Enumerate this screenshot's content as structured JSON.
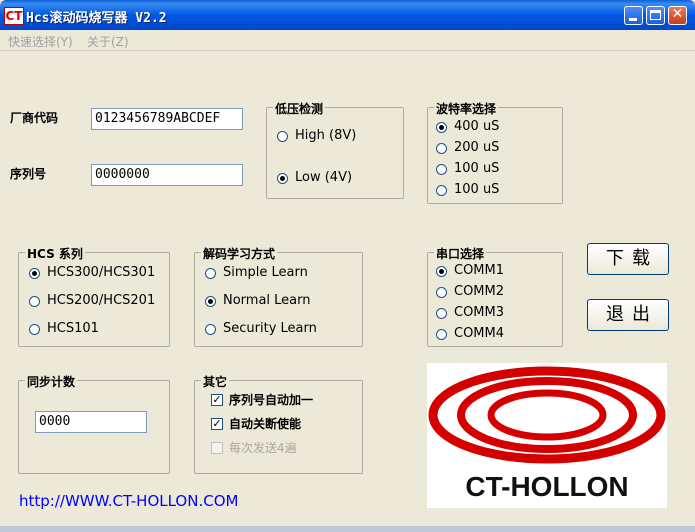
{
  "window": {
    "icon": "CT",
    "title": "Hcs滚动码烧写器 V2.2"
  },
  "menu": {
    "items": [
      "快速选择(Y)",
      "关于(Z)"
    ]
  },
  "manufacturer_code": {
    "label": "厂商代码",
    "value": "0123456789ABCDEF"
  },
  "serial_number": {
    "label": "序列号",
    "value": "0000000"
  },
  "low_voltage": {
    "title": "低压检测",
    "options": [
      "High (8V)",
      "Low  (4V)"
    ],
    "selected": "Low  (4V)"
  },
  "baud_rate": {
    "title": "波特率选择",
    "options": [
      "400 uS",
      "200 uS",
      "100 uS",
      "100 uS"
    ],
    "selected_index": 0
  },
  "hcs_series": {
    "title": "HCS 系列",
    "options": [
      "HCS300/HCS301",
      "HCS200/HCS201",
      "HCS101"
    ],
    "selected_index": 0
  },
  "learn_mode": {
    "title": "解码学习方式",
    "options": [
      "Simple Learn",
      "Normal Learn",
      "Security Learn"
    ],
    "selected_index": 1
  },
  "serial_port": {
    "title": "串口选择",
    "options": [
      "COMM1",
      "COMM2",
      "COMM3",
      "COMM4"
    ],
    "selected_index": 0
  },
  "buttons": {
    "download": "下载",
    "exit": "退出"
  },
  "sync_counter": {
    "title": "同步计数",
    "value": "0000"
  },
  "other": {
    "title": "其它",
    "options": [
      "序列号自动加一",
      "自动关断使能",
      "每次发送4遍"
    ],
    "checked": [
      true,
      true,
      false
    ],
    "enabled": [
      true,
      true,
      false
    ]
  },
  "website": "http://WWW.CT-HOLLON.COM",
  "logo": {
    "text": "CT-HOLLON",
    "color": "#D40000"
  }
}
